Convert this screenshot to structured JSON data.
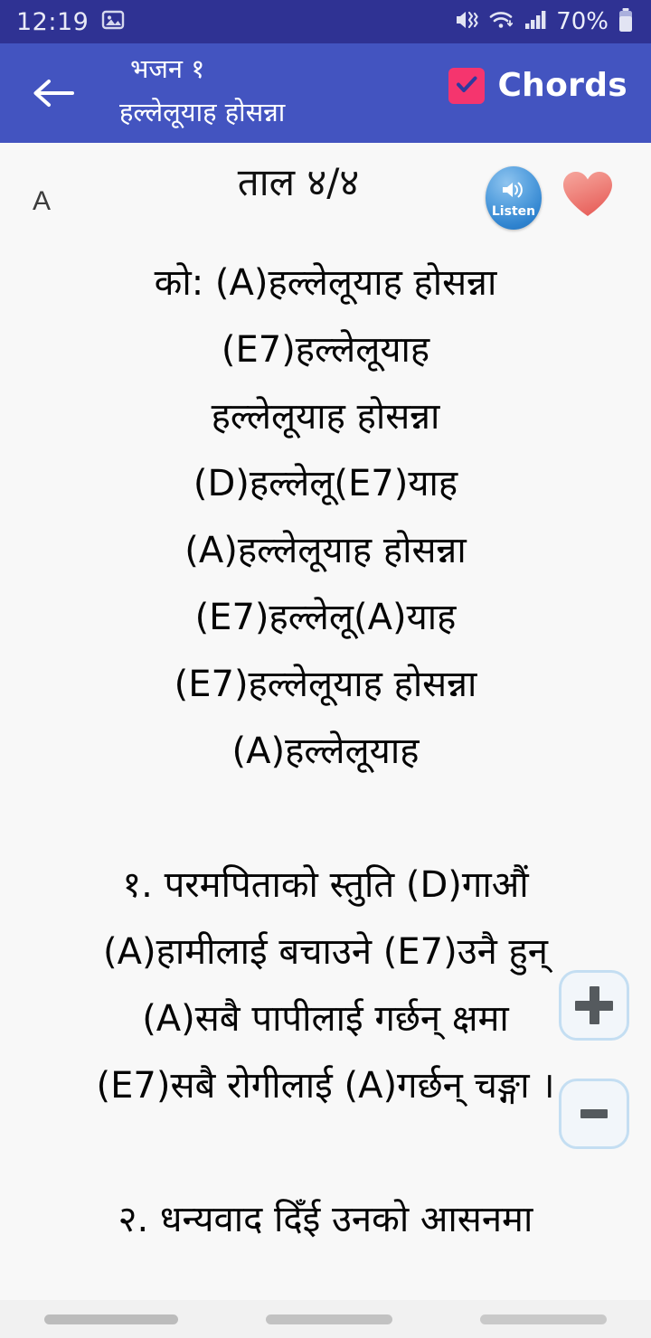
{
  "status_bar": {
    "time": "12:19",
    "battery_percent": "70%",
    "icons": [
      "image-notification-icon",
      "mute-vibrate-icon",
      "wifi-icon",
      "signal-bars-icon",
      "battery-icon"
    ]
  },
  "app_bar": {
    "back_icon": "back-arrow-icon",
    "title_line1": "भजन १",
    "title_line2": "हल्लेलूयाह होसन्ना",
    "chords_label": "Chords",
    "chords_checked": true,
    "colors": {
      "status_bar": "#2f3293",
      "app_bar": "#4354c0",
      "checkbox": "#f5356e"
    }
  },
  "song_header": {
    "key_label": "A",
    "tala": "ताल ४/४",
    "listen_label": "Listen",
    "favorite_icon": "heart-icon",
    "favorite_color": "#f08080"
  },
  "lyrics": {
    "lines": [
      "को: (A)हल्लेलूयाह होसन्ना",
      "(E7)हल्लेलूयाह",
      "हल्लेलूयाह होसन्ना",
      "(D)हल्लेलू(E7)याह",
      "(A)हल्लेलूयाह होसन्ना",
      "(E7)हल्लेलू(A)याह",
      "(E7)हल्लेलूयाह होसन्ना",
      "(A)हल्लेलूयाह",
      "",
      "१. परमपिताको स्तुति (D)गाऔं",
      "(A)हामीलाई बचाउने (E7)उनै हुन्",
      "(A)सबै पापीलाई गर्छन् क्षमा",
      "(E7)सबै रोगीलाई (A)गर्छन् चङ्गा ।",
      "",
      "२. धन्यवाद दिँई उनको आसनमा"
    ]
  },
  "floating_controls": {
    "zoom_in_label": "+",
    "zoom_out_label": "−"
  },
  "nav_bar": {
    "buttons": [
      "recents-pill",
      "home-pill",
      "back-pill"
    ]
  }
}
